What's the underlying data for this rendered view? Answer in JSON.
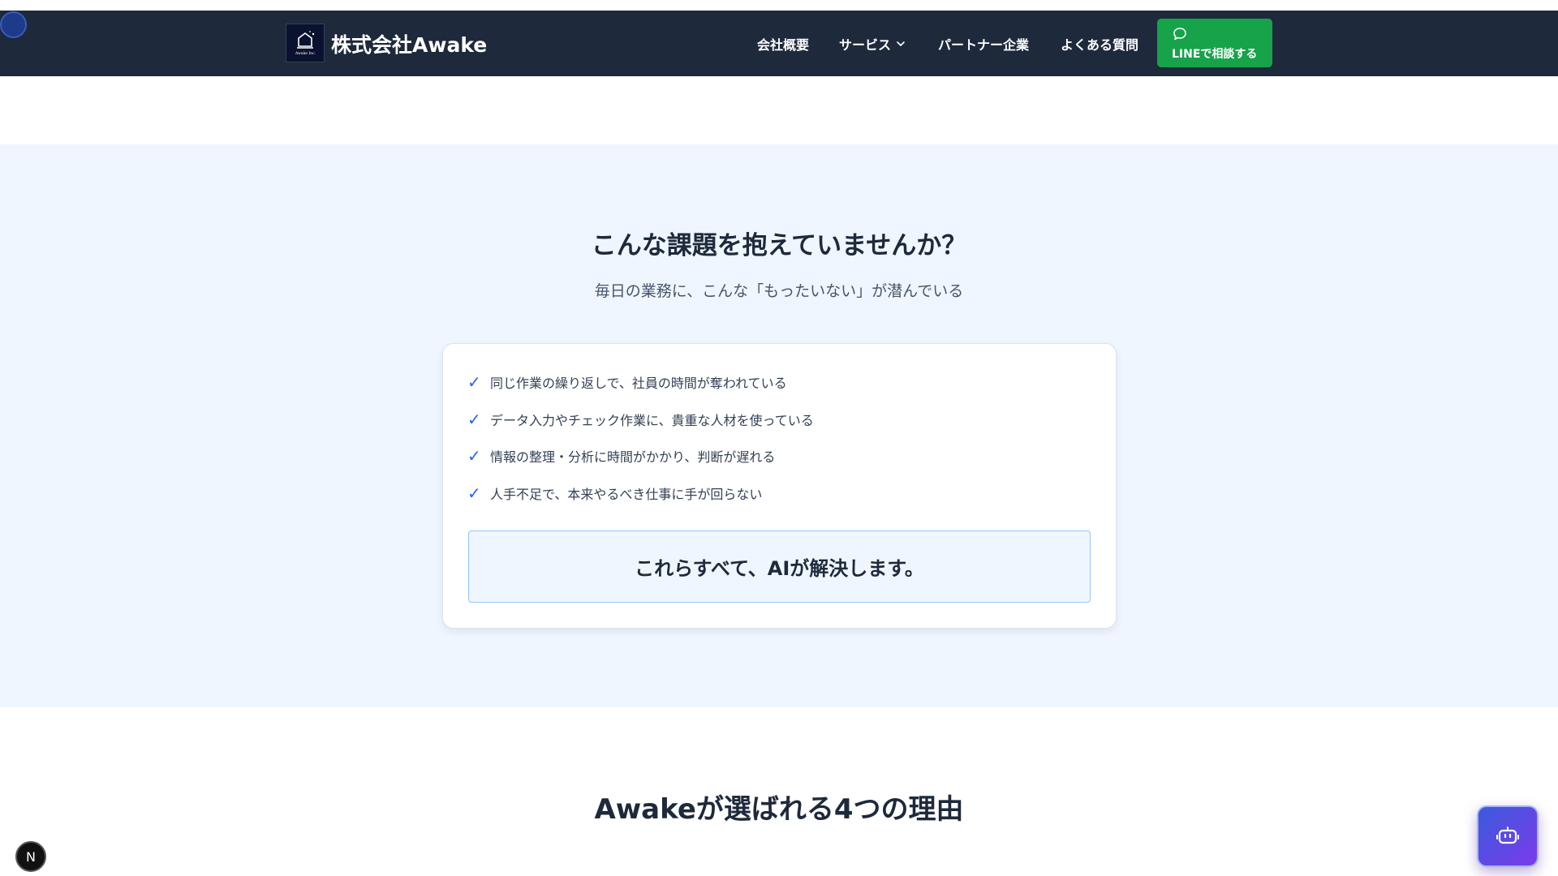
{
  "header": {
    "brand": "株式会社Awake",
    "logo_text": "Awake Inc.",
    "nav": {
      "company": "会社概要",
      "services": "サービス",
      "partners": "パートナー企業",
      "faq": "よくある質問"
    },
    "cta_label": "LINEで相談する",
    "cta_color": "#16a34a"
  },
  "problems": {
    "title": "こんな課題を抱えていませんか？",
    "subtitle": "毎日の業務に、こんな「もったいない」が潜んでいる",
    "items": [
      "同じ作業の繰り返しで、社員の時間が奪われている",
      "データ入力やチェック作業に、貴重な人材を使っている",
      "情報の整理・分析に時間がかかり、判断が遅れる",
      "人手不足で、本来やるべき仕事に手が回らない"
    ],
    "check_symbol": "✓",
    "solution": "これらすべて、AIが解決します。"
  },
  "reasons": {
    "title": "Awakeが選ばれる4つの理由"
  },
  "badge": {
    "letter": "N"
  },
  "icons": {
    "chat": "robot-icon",
    "cta": "chat-bubble-icon",
    "dropdown": "chevron-down-icon",
    "check": "check-icon"
  },
  "colors": {
    "header_bg": "#1e293b",
    "section_bg": "#eff6ff",
    "accent": "#2563eb"
  }
}
